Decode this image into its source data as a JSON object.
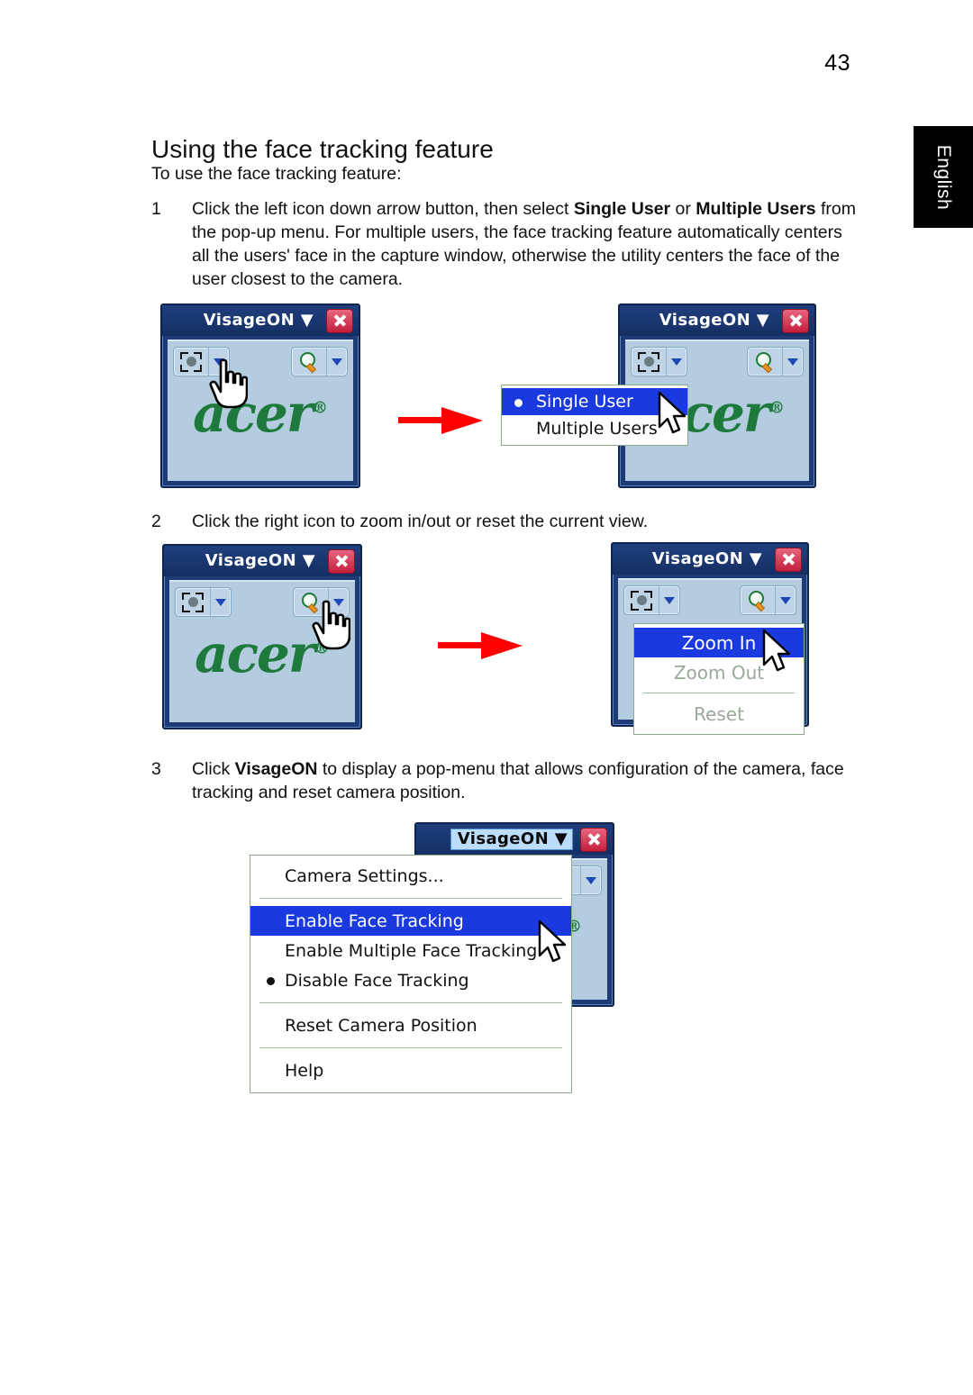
{
  "page": {
    "number": "43",
    "language_tab": "English",
    "heading": "Using the face tracking feature",
    "intro": "To use the face tracking feature:"
  },
  "steps": [
    {
      "number": "1",
      "text_parts": [
        {
          "t": "Click the left icon down arrow button, then select ",
          "bold": false
        },
        {
          "t": "Single User",
          "bold": true
        },
        {
          "t": " or ",
          "bold": false
        },
        {
          "t": "Multiple Users",
          "bold": true
        },
        {
          "t": " from the pop-up menu. For multiple users, the face tracking feature automatically centers all the users' face in the capture window, otherwise the utility centers the face of the user closest to the camera.",
          "bold": false
        }
      ]
    },
    {
      "number": "2",
      "text_parts": [
        {
          "t": "Click the right icon to zoom in/out or reset the current view.",
          "bold": false
        }
      ]
    },
    {
      "number": "3",
      "text_parts": [
        {
          "t": "Click ",
          "bold": false
        },
        {
          "t": "VisageON",
          "bold": true
        },
        {
          "t": " to display a pop-menu that allows configuration of the camera, face tracking and reset camera position.",
          "bold": false
        }
      ]
    }
  ],
  "app_window": {
    "title": "VisageON",
    "title_caret": "▼",
    "close_label": "x",
    "logo_text": "acer",
    "logo_reg": "®",
    "toolbar": {
      "face_button_icon": "face-focus-icon",
      "face_dropdown_caret": "▼",
      "zoom_button_icon": "magnifier-icon",
      "zoom_dropdown_caret": "▼"
    }
  },
  "menus": {
    "users": {
      "items": [
        {
          "label": "Single User",
          "selected": true,
          "bullet": true,
          "disabled": false
        },
        {
          "label": "Multiple Users",
          "selected": false,
          "bullet": false,
          "disabled": false
        }
      ]
    },
    "zoom": {
      "items": [
        {
          "label": "Zoom In",
          "selected": true,
          "disabled": false,
          "separator_after": false
        },
        {
          "label": "Zoom Out",
          "selected": false,
          "disabled": true,
          "separator_after": true
        },
        {
          "label": "Reset",
          "selected": false,
          "disabled": true,
          "separator_after": false
        }
      ]
    },
    "main": {
      "items": [
        {
          "label": "Camera Settings...",
          "selected": false,
          "bullet": false,
          "separator_after": true
        },
        {
          "label": "Enable Face Tracking",
          "selected": true,
          "bullet": false,
          "separator_after": false
        },
        {
          "label": "Enable Multiple Face Tracking",
          "selected": false,
          "bullet": false,
          "separator_after": false
        },
        {
          "label": "Disable Face Tracking",
          "selected": false,
          "bullet": true,
          "separator_after": true
        },
        {
          "label": "Reset Camera Position",
          "selected": false,
          "bullet": false,
          "separator_after": true
        },
        {
          "label": "Help",
          "selected": false,
          "bullet": false,
          "separator_after": false
        }
      ]
    }
  },
  "colors": {
    "title_bar": "#1d3c77",
    "client": "#b3ccdf",
    "menu_highlight": "#1a3ae0",
    "acer_green": "#1d7a3c",
    "close_red": "#c21f3c",
    "arrow_red": "#ff0000",
    "tab_black": "#000000"
  }
}
